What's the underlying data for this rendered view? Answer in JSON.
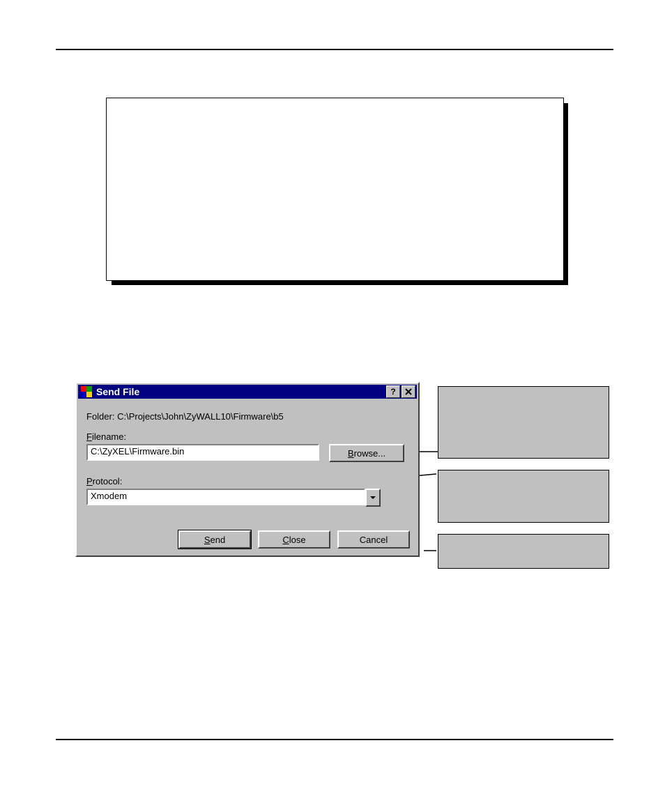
{
  "dialog": {
    "title": "Send File",
    "folder_label": "Folder:",
    "folder_value": "C:\\Projects\\John\\ZyWALL10\\Firmware\\b5",
    "filename_label": "Filename:",
    "filename_underline_char": "F",
    "filename_value": "C:\\ZyXEL\\Firmware.bin",
    "browse_label": "Browse...",
    "browse_underline_char": "B",
    "protocol_label": "Protocol:",
    "protocol_underline_char": "P",
    "protocol_value": "Xmodem",
    "buttons": {
      "send": "Send",
      "send_underline_char": "S",
      "close": "Close",
      "close_underline_char": "C",
      "cancel": "Cancel"
    },
    "titlebar_icons": {
      "help": "?",
      "close": "×"
    }
  },
  "annotations": {
    "a1": "",
    "a2": "",
    "a3": ""
  }
}
